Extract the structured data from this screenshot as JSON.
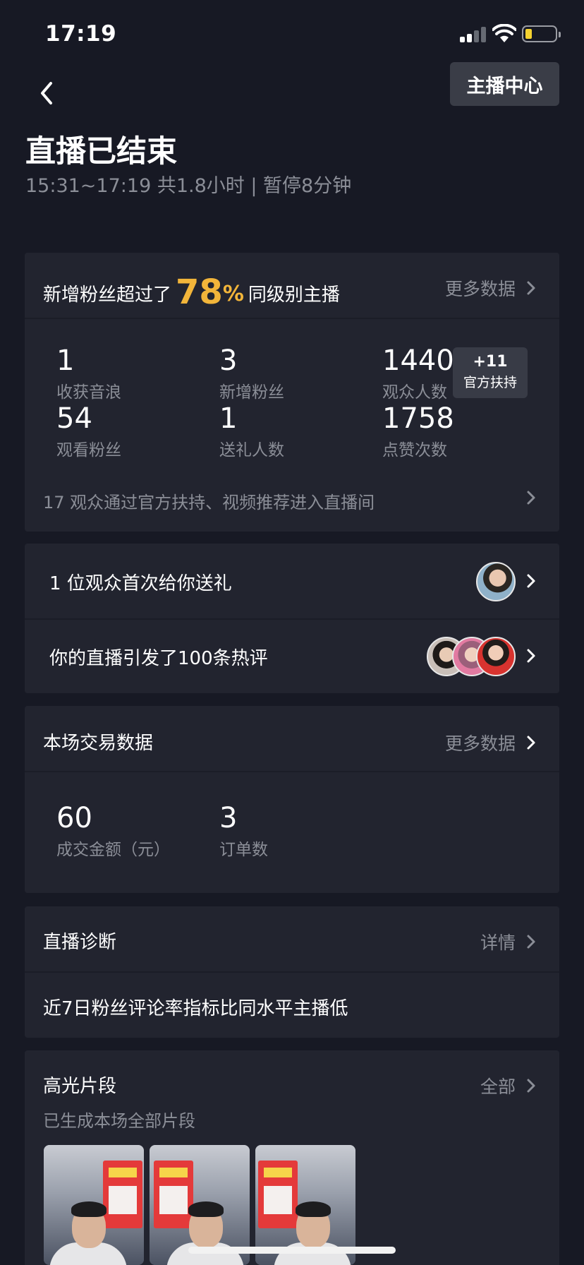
{
  "status_bar": {
    "time": "17:19"
  },
  "header": {
    "anchor_center_label": "主播中心",
    "title": "直播已结束",
    "subtitle": "15:31~17:19 共1.8小时 | 暂停8分钟"
  },
  "summary": {
    "headline_prefix": "新增粉丝超过了",
    "headline_percent": "78",
    "headline_percent_sign": "%",
    "headline_suffix": "同级别主播",
    "more_label": "更多数据",
    "stats": [
      {
        "value": "1",
        "label": "收获音浪"
      },
      {
        "value": "3",
        "label": "新增粉丝"
      },
      {
        "value": "1440",
        "label": "观众人数"
      },
      {
        "value": "54",
        "label": "观看粉丝"
      },
      {
        "value": "1",
        "label": "送礼人数"
      },
      {
        "value": "1758",
        "label": "点赞次数"
      }
    ],
    "official_badge": {
      "plus": "+11",
      "label": "官方扶持"
    },
    "footer_text": "17 观众通过官方扶持、视频推荐进入直播间"
  },
  "audience": {
    "gift_row": "1 位观众首次给你送礼",
    "comments_row": "你的直播引发了100条热评"
  },
  "trade": {
    "title": "本场交易数据",
    "more_label": "更多数据",
    "stats": [
      {
        "value": "60",
        "label": "成交金额（元）"
      },
      {
        "value": "3",
        "label": "订单数"
      }
    ]
  },
  "diagnosis": {
    "title": "直播诊断",
    "more_label": "详情",
    "text": "近7日粉丝评论率指标比同水平主播低"
  },
  "highlights": {
    "title": "高光片段",
    "more_label": "全部",
    "subtitle": "已生成本场全部片段"
  },
  "icons": {
    "back": "chevron-left-icon",
    "chevron": "chevron-right-icon",
    "wifi": "wifi-icon",
    "signal": "signal-icon",
    "battery": "battery-icon"
  },
  "colors": {
    "background": "#171924",
    "card": "#22242f",
    "accent": "#f2b53a",
    "muted_text": "#8b8e97",
    "battery_level": "#f5d230"
  }
}
